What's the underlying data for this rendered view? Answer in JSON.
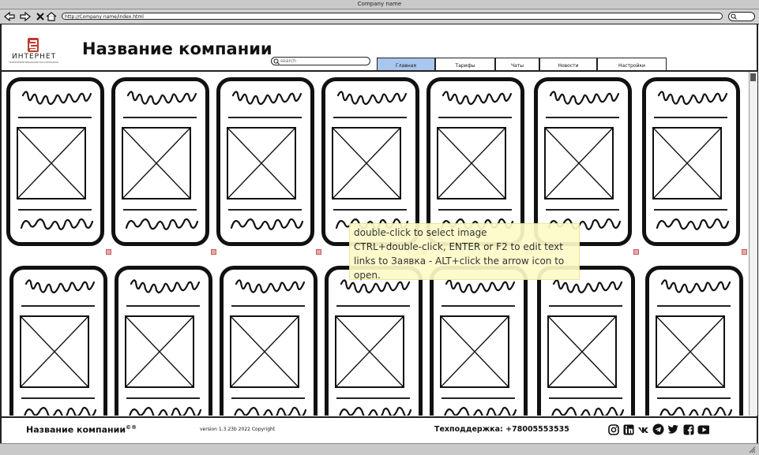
{
  "window": {
    "title": "Company name"
  },
  "browser": {
    "address": "http://Company name/index.html",
    "icons": [
      "back-icon",
      "forward-icon",
      "stop-icon",
      "home-icon",
      "search-icon"
    ]
  },
  "header": {
    "logo_text": "ИНТЕРНЕТ",
    "logo_sub": "ТЕЛЕКОММУНИКАЦИОННАЯ КОМПАНИЯ",
    "title": "Название компании",
    "search_placeholder": "search",
    "tabs": [
      {
        "label": "Главная",
        "active": true
      },
      {
        "label": "Тарифы",
        "active": false
      },
      {
        "label": "Чаты",
        "active": false
      },
      {
        "label": "Новости",
        "active": false
      },
      {
        "label": "Настройки",
        "active": false
      }
    ]
  },
  "tooltip": {
    "lines": [
      "double-click to select image",
      "CTRL+double-click, ENTER or F2 to edit text",
      "links to Заявка - ALT+click the arrow icon to",
      "open."
    ]
  },
  "footer": {
    "company": "Название компании",
    "trademark": "©®",
    "version": "version 1.3.23b 2022 Copyright",
    "support": "Техподдержка: +78005553535",
    "socials": [
      "instagram-icon",
      "linkedin-icon",
      "vk-icon",
      "telegram-icon",
      "twitter-icon",
      "facebook-icon",
      "youtube-icon"
    ]
  },
  "colors": {
    "active_tab": "#a9c7ee",
    "tooltip_bg": "#fdfbc8",
    "marker": "#f1a5a5"
  }
}
